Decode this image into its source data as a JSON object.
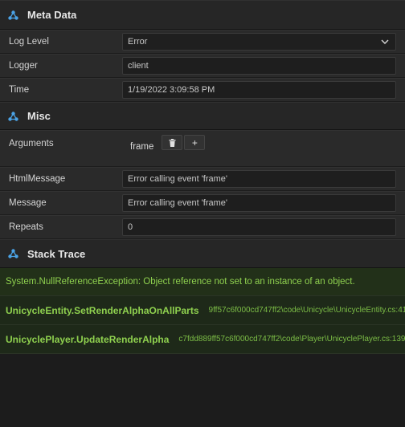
{
  "colors": {
    "accent": "#4ba3e6",
    "trace_green": "#8fd14f"
  },
  "sections": {
    "meta": {
      "title": "Meta Data",
      "icon": "triangle-nodes-icon"
    },
    "misc": {
      "title": "Misc",
      "icon": "triangle-nodes-icon"
    },
    "stack": {
      "title": "Stack Trace",
      "icon": "triangle-nodes-icon"
    }
  },
  "meta": {
    "log_level": {
      "label": "Log Level",
      "value": "Error"
    },
    "logger": {
      "label": "Logger",
      "value": "client"
    },
    "time": {
      "label": "Time",
      "value": "1/19/2022 3:09:58 PM"
    }
  },
  "misc": {
    "arguments": {
      "label": "Arguments",
      "name": "frame",
      "delete_icon": "trash-icon",
      "add_label": "+"
    },
    "html_message": {
      "label": "HtmlMessage",
      "value": "Error calling event 'frame'"
    },
    "message": {
      "label": "Message",
      "value": "Error calling event 'frame'"
    },
    "repeats": {
      "label": "Repeats",
      "value": "0"
    }
  },
  "stack": {
    "exception": "System.NullReferenceException: Object reference not set to an instance of an object.",
    "frames": [
      {
        "function": "UnicycleEntity.SetRenderAlphaOnAllParts",
        "location": "9ff57c6f000cd747ff2\\code\\Unicycle\\UnicycleEntity.cs:41"
      },
      {
        "function": "UnicyclePlayer.UpdateRenderAlpha",
        "location": "c7fdd889ff57c6f000cd747ff2\\code\\Player\\UnicyclePlayer.cs:139"
      }
    ]
  }
}
